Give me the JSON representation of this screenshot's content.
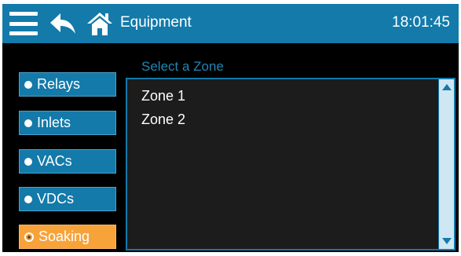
{
  "header": {
    "title": "Equipment",
    "clock": "18:01:45",
    "icons": [
      "menu-icon",
      "back-arrow-icon",
      "home-icon"
    ]
  },
  "nav": {
    "items": [
      {
        "label": "Relays",
        "active": false
      },
      {
        "label": "Inlets",
        "active": false
      },
      {
        "label": "VACs",
        "active": false
      },
      {
        "label": "VDCs",
        "active": false
      },
      {
        "label": "Soaking",
        "active": true
      }
    ]
  },
  "zones": {
    "header": "Select a Zone",
    "items": [
      "Zone 1",
      "Zone 2"
    ]
  },
  "colors": {
    "accent": "#137aaa",
    "active": "#f7a33a",
    "background": "#000000",
    "list_background": "#1c1c1c"
  }
}
